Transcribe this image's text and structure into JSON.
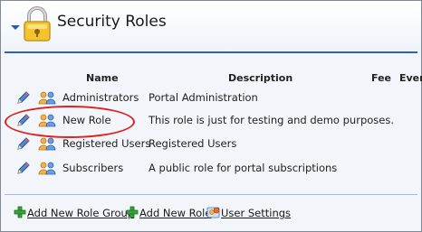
{
  "header": {
    "title": "Security Roles",
    "icons": {
      "collapse": "collapse-arrow-icon",
      "lock": "lock-icon"
    }
  },
  "table": {
    "columns": {
      "name": "Name",
      "description": "Description",
      "fee": "Fee",
      "every": "Ever"
    },
    "rows": [
      {
        "name": "Administrators",
        "description": "Portal Administration"
      },
      {
        "name": "New Role",
        "description": "This role is just for testing and demo purposes."
      },
      {
        "name": "Registered Users",
        "description": "Registered Users"
      },
      {
        "name": "Subscribers",
        "description": "A public role for portal subscriptions"
      }
    ],
    "row_icons": {
      "edit": "pencil-edit-icon",
      "role": "users-group-icon"
    }
  },
  "actions": {
    "add_role_group": "Add New Role Group",
    "add_role": "Add New Role",
    "user_settings": "User Settings"
  },
  "colors": {
    "accent": "#2f62b3",
    "highlight": "#e0201f",
    "panel_bg": "#f2f6fb"
  }
}
